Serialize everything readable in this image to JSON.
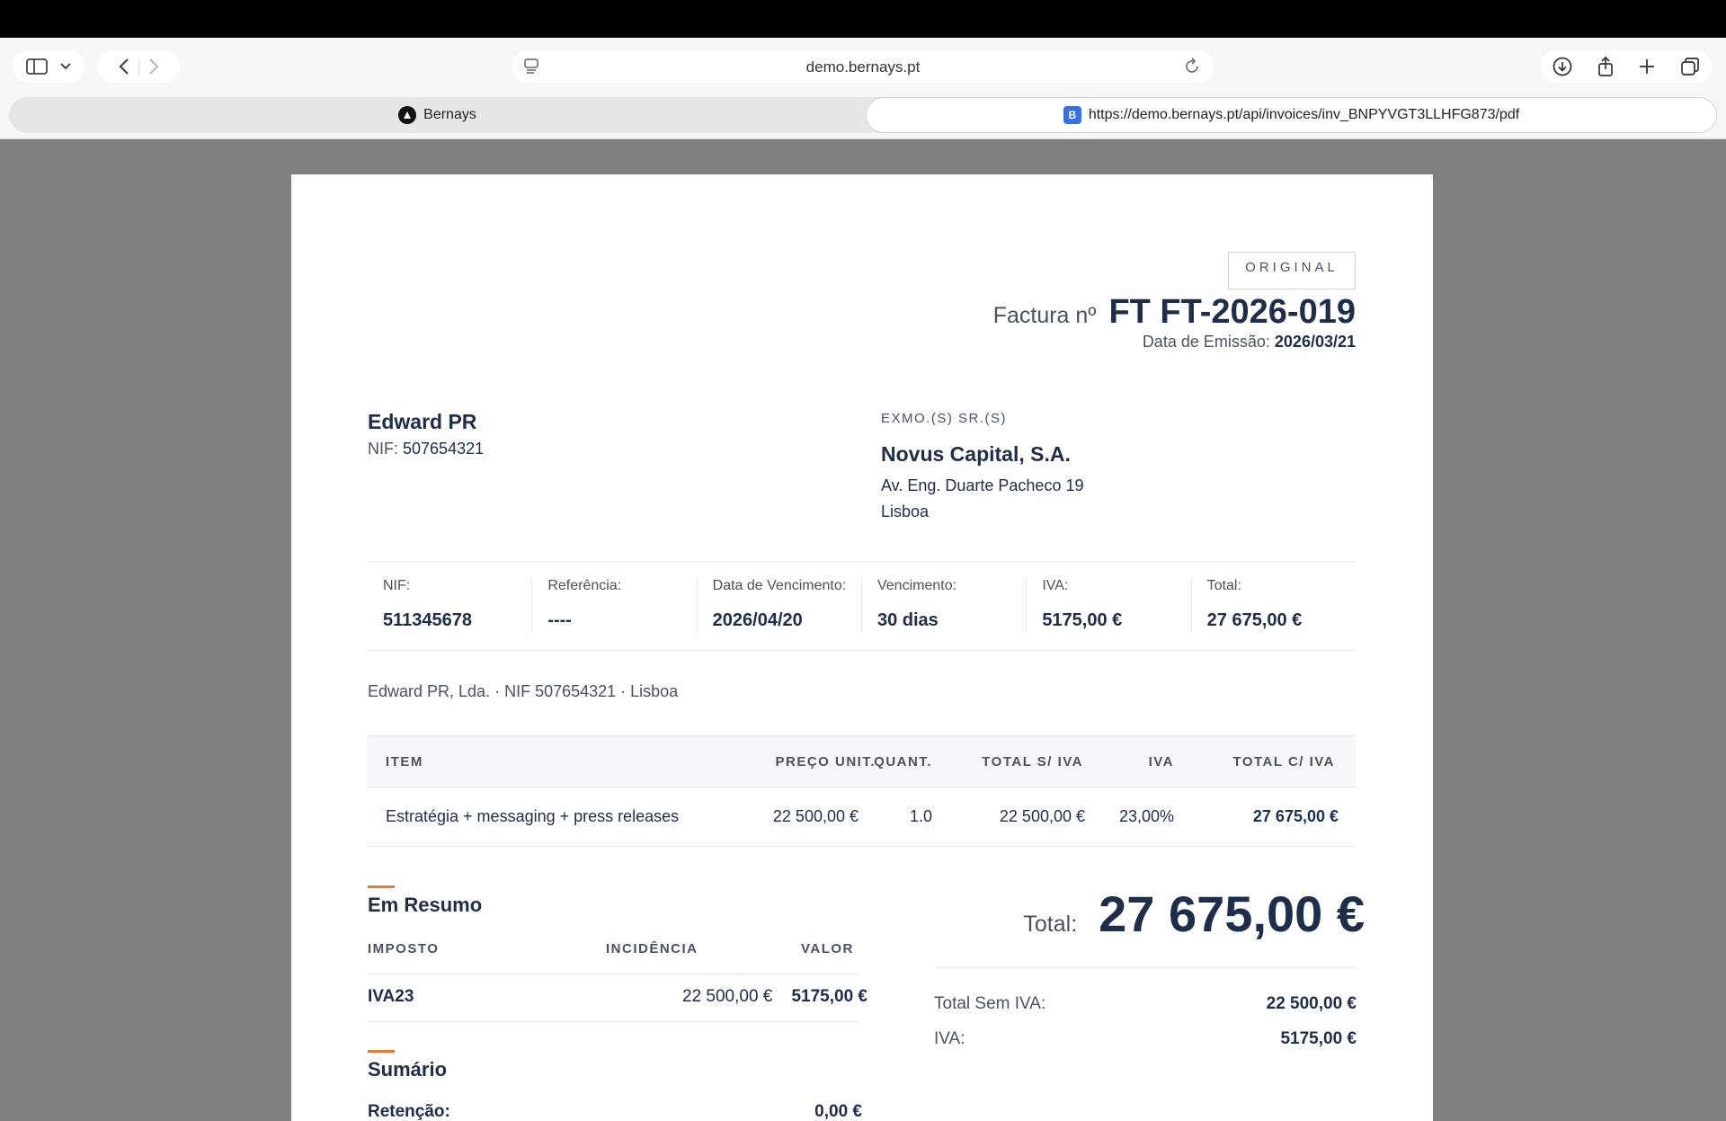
{
  "browser": {
    "address": "demo.bernays.pt",
    "tabs": [
      {
        "label": "Bernays"
      },
      {
        "label": "https://demo.bernays.pt/api/invoices/inv_BNPYVGT3LLHFG873/pdf",
        "favicon": "B"
      }
    ]
  },
  "invoice": {
    "badge": "ORIGINAL",
    "title_label": "Factura nº",
    "number": "FT FT-2026-019",
    "issue_label": "Data de Emissão:",
    "issue_date": "2026/03/21",
    "seller": {
      "name": "Edward PR",
      "nif_label": "NIF:",
      "nif": "507654321"
    },
    "client": {
      "salutation": "EXMO.(S) SR.(S)",
      "name": "Novus Capital, S.A.",
      "address1": "Av. Eng. Duarte Pacheco 19",
      "address2": "Lisboa"
    },
    "meta": [
      {
        "label": "NIF:",
        "value": "511345678"
      },
      {
        "label": "Referência:",
        "value": "----"
      },
      {
        "label": "Data de Vencimento:",
        "value": "2026/04/20"
      },
      {
        "label": "Vencimento:",
        "value": "30 dias"
      },
      {
        "label": "IVA:",
        "value": "5175,00 €"
      },
      {
        "label": "Total:",
        "value": "27 675,00 €"
      }
    ],
    "footer_line": "Edward PR, Lda. · NIF 507654321 · Lisboa",
    "items_headers": {
      "item": "ITEM",
      "unit_price": "PREÇO UNIT.",
      "qty": "QUANT.",
      "total_no_vat": "TOTAL S/ IVA",
      "vat": "IVA",
      "total_vat": "TOTAL C/ IVA"
    },
    "items": [
      {
        "item": "Estratégia + messaging + press releases",
        "unit_price": "22 500,00 €",
        "qty": "1.0",
        "total_no_vat": "22 500,00 €",
        "vat": "23,00%",
        "total_vat": "27 675,00 €"
      }
    ],
    "summary": {
      "title": "Em Resumo",
      "headers": {
        "tax": "IMPOSTO",
        "base": "INCIDÊNCIA",
        "value": "VALOR"
      },
      "rows": [
        {
          "tax": "IVA23",
          "base": "22 500,00 €",
          "value": "5175,00 €"
        }
      ]
    },
    "sumario": {
      "title": "Sumário",
      "retention_label": "Retenção:",
      "retention_value": "0,00 €"
    },
    "totals": {
      "total_label": "Total:",
      "total_value": "27 675,00 €",
      "no_vat_label": "Total Sem IVA:",
      "no_vat_value": "22 500,00 €",
      "vat_label": "IVA:",
      "vat_value": "5175,00 €"
    }
  },
  "colors": {
    "accent": "#e07b3a",
    "ink": "#1d2d4a",
    "viewer_bg": "#7f7f7f"
  }
}
